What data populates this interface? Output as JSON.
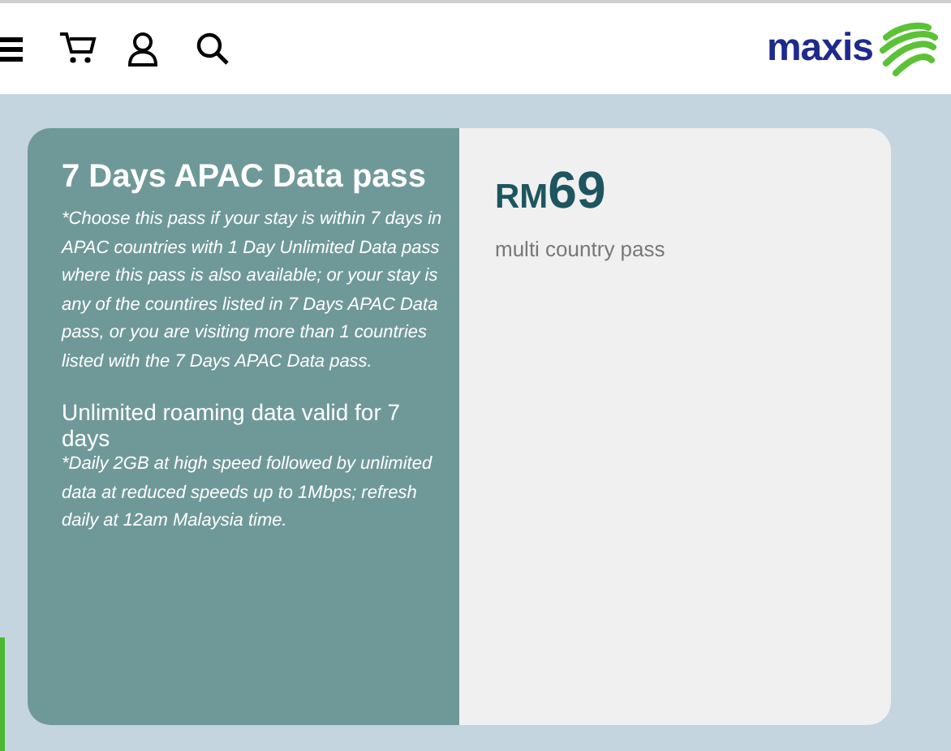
{
  "header": {
    "logo_text": "maxis"
  },
  "pass": {
    "title": "7 Days APAC Data pass",
    "note": "*Choose this pass if your stay is within 7 days in APAC countries with 1 Day Unlimited Data pass where this pass is also available; or your stay is any of the countires listed in 7 Days APAC Data pass, or you are visiting more than 1 countries listed with the 7 Days APAC Data pass.",
    "feature": "Unlimited roaming data valid for 7 days",
    "feature_note": "*Daily 2GB at high speed followed by unlimited data at reduced speeds up to 1Mbps; refresh daily at 12am Malaysia time.",
    "currency": "RM",
    "price": "69",
    "price_caption": "multi country pass"
  }
}
